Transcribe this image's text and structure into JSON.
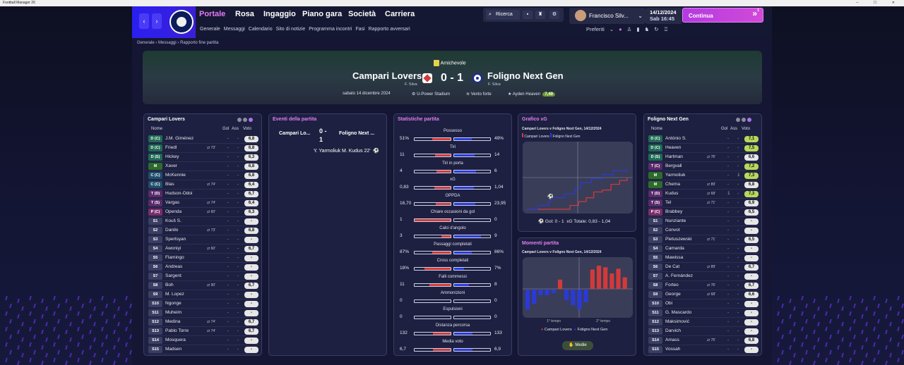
{
  "window": {
    "title": "Football Manager 26"
  },
  "nav": {
    "back": "‹",
    "fwd": "›"
  },
  "menu": [
    {
      "label": "Portale",
      "x": 282,
      "active": true
    },
    {
      "label": "Rosa",
      "x": 333
    },
    {
      "label": "Ingaggio",
      "x": 373
    },
    {
      "label": "Piano gara",
      "x": 428
    },
    {
      "label": "Società",
      "x": 493
    },
    {
      "label": "Carriera",
      "x": 545
    }
  ],
  "submenu": [
    "Generale",
    "Messaggi",
    "Calendario",
    "Sito di notizie",
    "Programma incontri",
    "Fasi",
    "Rapporto avversari"
  ],
  "search": {
    "label": "Ricerca"
  },
  "manager": {
    "name": "Francisco Silv..."
  },
  "date": {
    "day": "14/12/2024",
    "time": "Sab 16:45"
  },
  "continua": {
    "label": "Continua",
    "badge": "1"
  },
  "preferiti": {
    "label": "Preferiti"
  },
  "breadcrumb": [
    "Generale",
    "Messaggi",
    "Rapporto fine partita"
  ],
  "match": {
    "competition": "Amichevole",
    "home": "Campari Lovers",
    "away": "Foligno Next Gen",
    "score": "0 - 1",
    "home_manager": "F. Silva",
    "away_manager": "F. Silva",
    "date": "sabato 14 dicembre 2024",
    "stadium": "U-Power Stadium",
    "weather": "Vento forte",
    "potm": "Ayden Heaven",
    "potm_rating": "7,49"
  },
  "homePanel": {
    "title": "Campari Lovers",
    "cols": [
      "Nome",
      "Gol",
      "Ass",
      "Voto"
    ],
    "rows": [
      {
        "pos": "D (C)",
        "c": "pd",
        "name": "J.M. Giménez",
        "g": "-",
        "a": "-",
        "r": "6,8"
      },
      {
        "pos": "D (C)",
        "c": "pd",
        "name": "Friedl",
        "ev": "⇄ 73'",
        "g": "-",
        "a": "-",
        "r": "6,8"
      },
      {
        "pos": "D (S)",
        "c": "pd",
        "name": "Hickey",
        "g": "-",
        "a": "-",
        "r": "6,3"
      },
      {
        "pos": "M",
        "c": "pm",
        "name": "Xaver",
        "g": "-",
        "a": "-",
        "r": "6,8"
      },
      {
        "pos": "C (C)",
        "c": "pc",
        "name": "McKennie",
        "g": "-",
        "a": "-",
        "r": "6,8"
      },
      {
        "pos": "C (C)",
        "c": "pc",
        "name": "Blas",
        "ev": "⇄ 74'",
        "g": "-",
        "a": "-",
        "r": "6,4"
      },
      {
        "pos": "T (D)",
        "c": "pt",
        "name": "Hudson-Odoi",
        "g": "-",
        "a": "-",
        "r": "6,7"
      },
      {
        "pos": "T (S)",
        "c": "pt",
        "name": "Vargas",
        "ev": "⇄ 74'",
        "g": "-",
        "a": "-",
        "r": "6,4"
      },
      {
        "pos": "P (C)",
        "c": "pp",
        "name": "Openda",
        "ev": "⇄ 60'",
        "g": "-",
        "a": "-",
        "r": "6,3"
      },
      {
        "pos": "S1",
        "c": "ps",
        "name": "Kouš S.",
        "g": "-",
        "a": "-",
        "r": "-"
      },
      {
        "pos": "S2",
        "c": "ps",
        "name": "Danilo",
        "ev": "⇄ 73'",
        "g": "-",
        "a": "-",
        "r": "6,8"
      },
      {
        "pos": "S3",
        "c": "ps",
        "name": "Spertsyan",
        "g": "-",
        "a": "-",
        "r": "-"
      },
      {
        "pos": "S4",
        "c": "ps",
        "name": "Awoniyi",
        "ev": "⇄ 60'",
        "g": "-",
        "a": "-",
        "r": "6,7"
      },
      {
        "pos": "S5",
        "c": "ps",
        "name": "Flamingo",
        "g": "-",
        "a": "-",
        "r": "-"
      },
      {
        "pos": "S6",
        "c": "ps",
        "name": "Andreas",
        "g": "-",
        "a": "-",
        "r": "-"
      },
      {
        "pos": "S7",
        "c": "ps",
        "name": "Sargent",
        "g": "-",
        "a": "-",
        "r": "-"
      },
      {
        "pos": "S8",
        "c": "ps",
        "name": "Boh",
        "ev": "⇄ 90'",
        "g": "-",
        "a": "-",
        "r": "6,7"
      },
      {
        "pos": "S9",
        "c": "ps",
        "name": "M. Lopez",
        "g": "-",
        "a": "-",
        "r": "-"
      },
      {
        "pos": "S10",
        "c": "ps",
        "name": "Ngonge",
        "g": "-",
        "a": "-",
        "r": "-"
      },
      {
        "pos": "S11",
        "c": "ps",
        "name": "Muheim",
        "g": "-",
        "a": "-",
        "r": "-"
      },
      {
        "pos": "S12",
        "c": "ps",
        "name": "Medina",
        "ev": "⇄ 74'",
        "g": "-",
        "a": "-",
        "r": "6,7"
      },
      {
        "pos": "S13",
        "c": "ps",
        "name": "Pablo Torre",
        "ev": "⇄ 74'",
        "g": "-",
        "a": "-",
        "r": "6,7"
      },
      {
        "pos": "S14",
        "c": "ps",
        "name": "Mosquera",
        "g": "-",
        "a": "-",
        "r": "-"
      },
      {
        "pos": "S15",
        "c": "ps",
        "name": "Madsen",
        "g": "-",
        "a": "-",
        "r": "-"
      }
    ]
  },
  "awayPanel": {
    "title": "Foligno Next Gen",
    "cols": [
      "Nome",
      "Gol",
      "Ass",
      "Voto"
    ],
    "rows": [
      {
        "pos": "D (C)",
        "c": "pd",
        "name": "António S.",
        "g": "-",
        "a": "-",
        "r": "7,1",
        "rc": "gr"
      },
      {
        "pos": "D (C)",
        "c": "pd",
        "name": "Heaven",
        "g": "-",
        "a": "-",
        "r": "7,5",
        "rc": "gr"
      },
      {
        "pos": "D (S)",
        "c": "pd",
        "name": "Hartman",
        "ev": "⇄ 76'",
        "g": "-",
        "a": "-",
        "r": "6,6"
      },
      {
        "pos": "T (C)",
        "c": "pt",
        "name": "Bergvall",
        "g": "-",
        "a": "-",
        "r": "7,2",
        "rc": "gr"
      },
      {
        "pos": "M",
        "c": "pm",
        "name": "Yarmoliuk",
        "g": "-",
        "a": "1",
        "r": "7,3",
        "rc": "gr"
      },
      {
        "pos": "M",
        "c": "pm",
        "name": "Chema",
        "ev": "⇄ 89'",
        "g": "-",
        "a": "-",
        "r": "6,8"
      },
      {
        "pos": "T (D)",
        "c": "pt",
        "name": "Kudus",
        "ev": "⇄ 68'",
        "g": "1",
        "a": "-",
        "r": "7,3",
        "rc": "gr"
      },
      {
        "pos": "T (S)",
        "c": "pt",
        "name": "Tel",
        "ev": "⇄ 71'",
        "g": "-",
        "a": "-",
        "r": "6,9"
      },
      {
        "pos": "P (C)",
        "c": "pp",
        "name": "Brabbey",
        "g": "-",
        "a": "-",
        "r": "6,5"
      },
      {
        "pos": "S1",
        "c": "ps",
        "name": "Nunziante",
        "g": "-",
        "a": "-",
        "r": "-"
      },
      {
        "pos": "S2",
        "c": "ps",
        "name": "Convot",
        "g": "-",
        "a": "-",
        "r": "-"
      },
      {
        "pos": "S3",
        "c": "ps",
        "name": "Pietuszewski",
        "ev": "⇄ 71'",
        "g": "-",
        "a": "-",
        "r": "6,5"
      },
      {
        "pos": "S4",
        "c": "ps",
        "name": "Camarda",
        "g": "-",
        "a": "-",
        "r": "-"
      },
      {
        "pos": "S5",
        "c": "ps",
        "name": "Mawissa",
        "g": "-",
        "a": "-",
        "r": "-"
      },
      {
        "pos": "S6",
        "c": "ps",
        "name": "De Cat",
        "ev": "⇄ 89'",
        "g": "-",
        "a": "-",
        "r": "6,7"
      },
      {
        "pos": "S7",
        "c": "ps",
        "name": "A. Fernández",
        "g": "-",
        "a": "-",
        "r": "-"
      },
      {
        "pos": "S8",
        "c": "ps",
        "name": "Forteo",
        "ev": "⇄ 76'",
        "g": "-",
        "a": "-",
        "r": "6,7"
      },
      {
        "pos": "S9",
        "c": "ps",
        "name": "George",
        "ev": "⇄ 68'",
        "g": "-",
        "a": "-",
        "r": "6,6"
      },
      {
        "pos": "S10",
        "c": "ps",
        "name": "Obi",
        "g": "-",
        "a": "-",
        "r": "-"
      },
      {
        "pos": "S11",
        "c": "ps",
        "name": "G. Mascardo",
        "g": "-",
        "a": "-",
        "r": "-"
      },
      {
        "pos": "S12",
        "c": "ps",
        "name": "Maksimović",
        "g": "-",
        "a": "-",
        "r": "-"
      },
      {
        "pos": "S13",
        "c": "ps",
        "name": "Darvich",
        "g": "-",
        "a": "-",
        "r": "-"
      },
      {
        "pos": "S14",
        "c": "ps",
        "name": "Amass",
        "ev": "⇄ 75'",
        "g": "-",
        "a": "-",
        "r": "6,8"
      },
      {
        "pos": "S15",
        "c": "ps",
        "name": "Vossah",
        "g": "-",
        "a": "-",
        "r": "-"
      }
    ]
  },
  "events": {
    "title": "Eventi della partita",
    "home": "Campari Lo...",
    "score": "0 - 1",
    "away": "Foligno Next ...",
    "line": "Y. Yarmoliuk",
    "scorer": "M. Kudus 22'"
  },
  "stats": {
    "title": "Statistiche partita",
    "rows": [
      {
        "label": "Possesso",
        "l": "51%",
        "r": "49%",
        "lv": 51,
        "rv": 49
      },
      {
        "label": "Tiri",
        "l": "11",
        "r": "14",
        "lv": 11,
        "rv": 14
      },
      {
        "label": "Tiri in porta",
        "l": "4",
        "r": "6",
        "lv": 4,
        "rv": 6
      },
      {
        "label": "xG",
        "l": "0,83",
        "r": "1,04",
        "lv": 0.83,
        "rv": 1.04
      },
      {
        "label": "OPPDA",
        "l": "16,70",
        "r": "23,95",
        "lv": 16.7,
        "rv": 23.95
      },
      {
        "label": "Chiare occasioni da gol",
        "l": "1",
        "r": "0",
        "lv": 1,
        "rv": 0
      },
      {
        "label": "Calci d'angolo",
        "l": "3",
        "r": "9",
        "lv": 3,
        "rv": 9
      },
      {
        "label": "Passaggi completati",
        "l": "87%",
        "r": "86%",
        "lv": 87,
        "rv": 86
      },
      {
        "label": "Cross completati",
        "l": "18%",
        "r": "7%",
        "lv": 18,
        "rv": 7
      },
      {
        "label": "Falli commessi",
        "l": "11",
        "r": "8",
        "lv": 11,
        "rv": 8
      },
      {
        "label": "Ammonizioni",
        "l": "0",
        "r": "0",
        "lv": 0,
        "rv": 0
      },
      {
        "label": "Espulsioni",
        "l": "0",
        "r": "0",
        "lv": 0,
        "rv": 0
      },
      {
        "label": "Distanza percorsa",
        "l": "132",
        "r": "133",
        "lv": 132,
        "rv": 133
      },
      {
        "label": "Media voto",
        "l": "6,7",
        "r": "6,9",
        "lv": 6.7,
        "rv": 6.9
      }
    ]
  },
  "xg": {
    "title": "Grafico xG",
    "subtitle": "Campari Lovers v Foligno Next Gen, 14/12/2024",
    "legend_home": "Campari Lovers",
    "legend_away": "Foligno Next Gen",
    "goals": "Gol: 0 - 1",
    "totals": "xG Totale: 0,83 - 1,04"
  },
  "momenti": {
    "title": "Momenti partita",
    "subtitle": "Campari Lovers v Foligno Next Gen, 14/12/2024",
    "first": "1° tempo",
    "second": "2° tempo",
    "legend_home": "Campari Lovers",
    "legend_away": "Foligno Next Gen",
    "button": "Medie"
  },
  "colors": {
    "home": "#d23a3a",
    "away": "#2a3ad8",
    "accent": "#e27ef3"
  },
  "chart_data": [
    {
      "type": "line",
      "title": "Grafico xG",
      "series": [
        {
          "name": "Campari Lovers",
          "x": [
            0,
            40,
            48,
            55,
            62,
            70,
            78,
            86,
            93
          ],
          "y": [
            0,
            0.1,
            0.2,
            0.3,
            0.45,
            0.5,
            0.65,
            0.75,
            0.83
          ]
        },
        {
          "name": "Foligno Next Gen",
          "x": [
            0,
            10,
            20,
            22,
            35,
            45,
            50,
            60,
            70,
            80,
            93
          ],
          "y": [
            0,
            0.1,
            0.2,
            0.3,
            0.4,
            0.55,
            0.7,
            0.8,
            0.9,
            1.0,
            1.04
          ]
        }
      ]
    },
    {
      "type": "bar",
      "title": "Momenti partita",
      "series": [
        {
          "name": "Campari Lovers",
          "values": [
            0,
            0,
            0,
            0,
            0,
            1.2,
            0,
            0,
            0,
            0,
            2.5,
            3,
            2.8,
            2,
            2.6,
            1.5
          ]
        },
        {
          "name": "Foligno Next Gen",
          "values": [
            2.8,
            2,
            0.8,
            0.8,
            0.5,
            0,
            1.5,
            2.2,
            2.8,
            1.8,
            0,
            0,
            0,
            0,
            0,
            0
          ]
        }
      ]
    }
  ]
}
